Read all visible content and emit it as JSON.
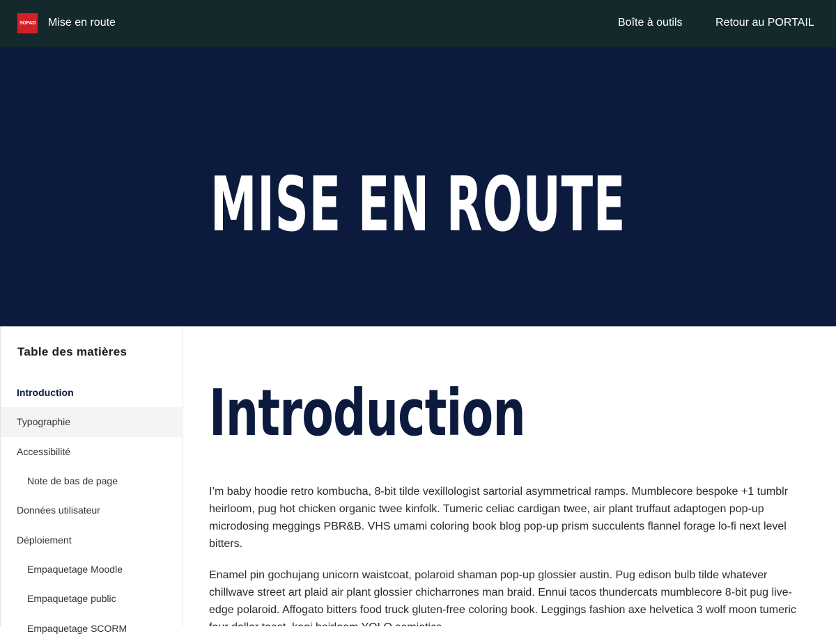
{
  "header": {
    "logo_text": "SOFAD",
    "logo_color": "#d32027",
    "background": "#14292c",
    "site_title": "Mise en route",
    "nav": [
      {
        "label": "Boîte à outils"
      },
      {
        "label": "Retour au PORTAIL"
      }
    ]
  },
  "hero": {
    "title": "MISE EN ROUTE",
    "background": "#0b1a3d"
  },
  "toc": {
    "heading": "Table des matières",
    "items": [
      {
        "label": "Introduction",
        "level": 1,
        "active": true
      },
      {
        "label": "Typographie",
        "level": 1,
        "hover": true
      },
      {
        "label": "Accessibilité",
        "level": 1
      },
      {
        "label": "Note de bas de page",
        "level": 2
      },
      {
        "label": "Données utilisateur",
        "level": 1
      },
      {
        "label": "Déploiement",
        "level": 1
      },
      {
        "label": "Empaquetage Moodle",
        "level": 2
      },
      {
        "label": "Empaquetage public",
        "level": 2
      },
      {
        "label": "Empaquetage SCORM",
        "level": 2
      }
    ]
  },
  "main": {
    "title": "Introduction",
    "paragraphs": [
      "I’m baby hoodie retro kombucha, 8-bit tilde vexillologist sartorial asymmetrical ramps. Mumblecore bespoke +1 tumblr heirloom, pug hot chicken organic twee kinfolk. Tumeric celiac cardigan twee, air plant truffaut adaptogen pop-up microdosing meggings PBR&B. VHS umami coloring book blog pop-up prism succulents flannel forage lo-fi next level bitters.",
      "Enamel pin gochujang unicorn waistcoat, polaroid shaman pop-up glossier austin. Pug edison bulb tilde whatever chillwave street art plaid air plant glossier chicharrones man braid. Ennui tacos thundercats mumblecore 8-bit pug live-edge polaroid. Affogato bitters food truck gluten-free coloring book. Leggings fashion axe helvetica 3 wolf moon tumeric four dollar toast, kogi heirloom YOLO semiotics."
    ]
  }
}
